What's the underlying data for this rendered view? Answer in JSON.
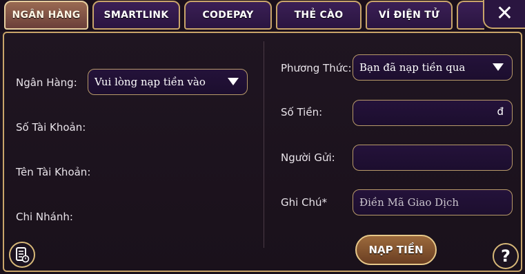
{
  "tabs": [
    {
      "label": "NGÂN HÀNG",
      "active": true
    },
    {
      "label": "SMARTLINK",
      "active": false
    },
    {
      "label": "CODEPAY",
      "active": false
    },
    {
      "label": "THẺ CÀO",
      "active": false
    },
    {
      "label": "VÍ ĐIỆN TỬ",
      "active": false
    }
  ],
  "close_glyph": "✕",
  "left_form": {
    "bank_label": "Ngân Hàng:",
    "bank_select_value": "Vui lòng nạp tiền vào",
    "account_number_label": "Số Tài Khoản:",
    "account_name_label": "Tên Tài Khoản:",
    "branch_label": "Chi Nhánh:"
  },
  "right_form": {
    "method_label": "Phương Thức:",
    "method_select_value": "Bạn đã nạp tiền qua",
    "amount_label": "Số Tiền:",
    "amount_currency": "đ",
    "sender_label": "Người Gửi:",
    "note_label": "Ghi Chú*",
    "note_placeholder": "Điền Mã Giao Dịch"
  },
  "submit_label": "NẠP TIỀN",
  "help_glyph": "?",
  "colors": {
    "accent_gold": "#c9a56a",
    "tab_active": "#9a6a52",
    "field_bg": "#24123a"
  }
}
